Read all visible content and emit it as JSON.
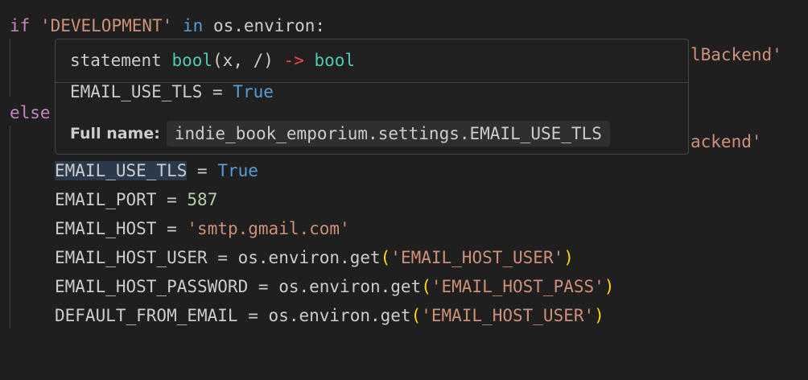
{
  "code": {
    "line1": {
      "kw_if": "if",
      "str_dev": "'DEVELOPMENT'",
      "kw_in": "in",
      "rest": "os.environ:"
    },
    "line2_tail": "lBackend'",
    "line3_else": "else",
    "line4_tail": "ackend'",
    "line5": {
      "name": "EMAIL_USE_TLS",
      "op": "=",
      "value": "True"
    },
    "line6": {
      "name": "EMAIL_PORT",
      "op": "=",
      "value": "587"
    },
    "line7": {
      "name": "EMAIL_HOST",
      "op": "=",
      "value": "'smtp.gmail.com'"
    },
    "line8": {
      "name": "EMAIL_HOST_USER",
      "op": "=",
      "call": "os.environ.get",
      "open": "(",
      "arg": "'EMAIL_HOST_USER'",
      "close": ")"
    },
    "line9": {
      "name": "EMAIL_HOST_PASSWORD",
      "op": "=",
      "call": "os.environ.get",
      "open": "(",
      "arg": "'EMAIL_HOST_PASS'",
      "close": ")"
    },
    "line10": {
      "name": "DEFAULT_FROM_EMAIL",
      "op": "=",
      "call": "os.environ.get",
      "open": "(",
      "arg": "'EMAIL_HOST_USER'",
      "close": ")"
    }
  },
  "hover": {
    "sig_prefix": "statement",
    "sig_type": "bool",
    "sig_args": "(x, /)",
    "sig_arrow": "->",
    "sig_return": "bool",
    "value_name": "EMAIL_USE_TLS",
    "value_op": "=",
    "value_val": "True",
    "full_label": "Full name:",
    "full_value": "indie_book_emporium.settings.EMAIL_USE_TLS"
  }
}
